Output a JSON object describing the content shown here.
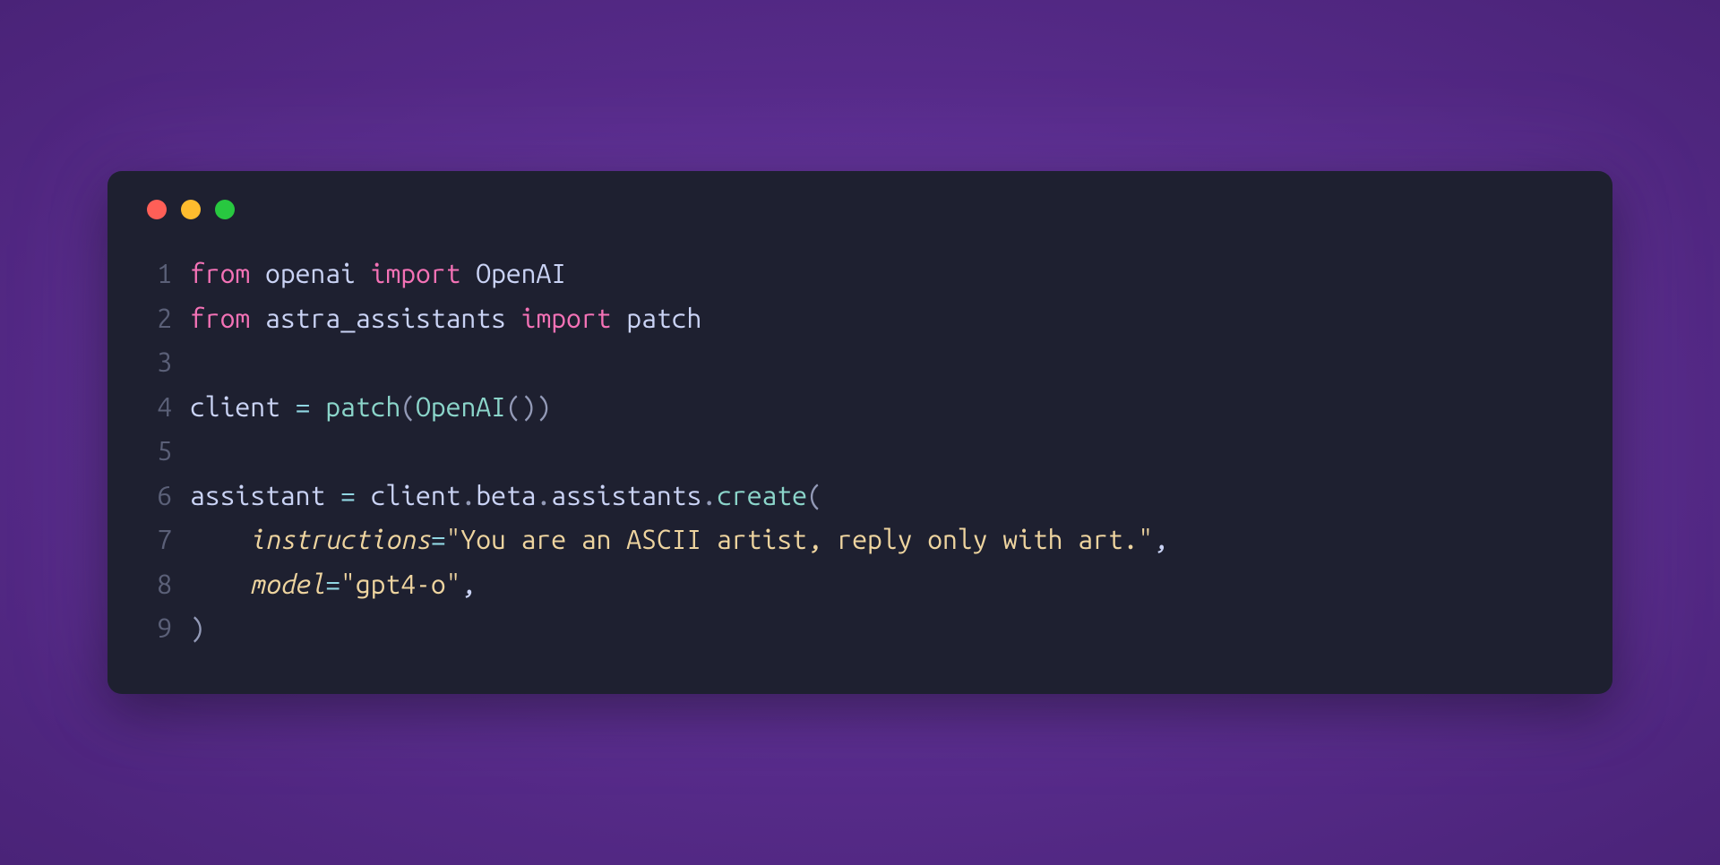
{
  "colors": {
    "background_outer": "#5a2d8e",
    "background_inner": "#1e2030",
    "control_close": "#ff5f57",
    "control_minimize": "#febc2e",
    "control_maximize": "#28c840",
    "line_number": "#5b6078",
    "keyword": "#f472b6",
    "default_text": "#cad3f5",
    "function": "#8bd5ca",
    "string": "#eed49f",
    "param": "#eed49f",
    "operator": "#91d7e3",
    "punct": "#939ab7"
  },
  "line_numbers": {
    "n1": "1",
    "n2": "2",
    "n3": "3",
    "n4": "4",
    "n5": "5",
    "n6": "6",
    "n7": "7",
    "n8": "8",
    "n9": "9"
  },
  "code": {
    "l1": {
      "from": "from",
      "mod1": "openai",
      "import": "import",
      "name1": "OpenAI"
    },
    "l2": {
      "from": "from",
      "mod2": "astra_assistants",
      "import": "import",
      "name2": "patch"
    },
    "l4": {
      "var": "client",
      "eq": "=",
      "fn": "patch",
      "lp1": "(",
      "cls": "OpenAI",
      "lp2": "(",
      "rp2": ")",
      "rp1": ")"
    },
    "l6": {
      "var": "assistant",
      "eq": "=",
      "obj": "client",
      "dot1": ".",
      "attr1": "beta",
      "dot2": ".",
      "attr2": "assistants",
      "dot3": ".",
      "method": "create",
      "lp": "("
    },
    "l7": {
      "indent": "    ",
      "param": "instructions",
      "eq": "=",
      "str": "\"You are an ASCII artist, reply only with art.\"",
      "comma": ","
    },
    "l8": {
      "indent": "    ",
      "param": "model",
      "eq": "=",
      "str": "\"gpt4-o\"",
      "comma": ","
    },
    "l9": {
      "rp": ")"
    }
  }
}
